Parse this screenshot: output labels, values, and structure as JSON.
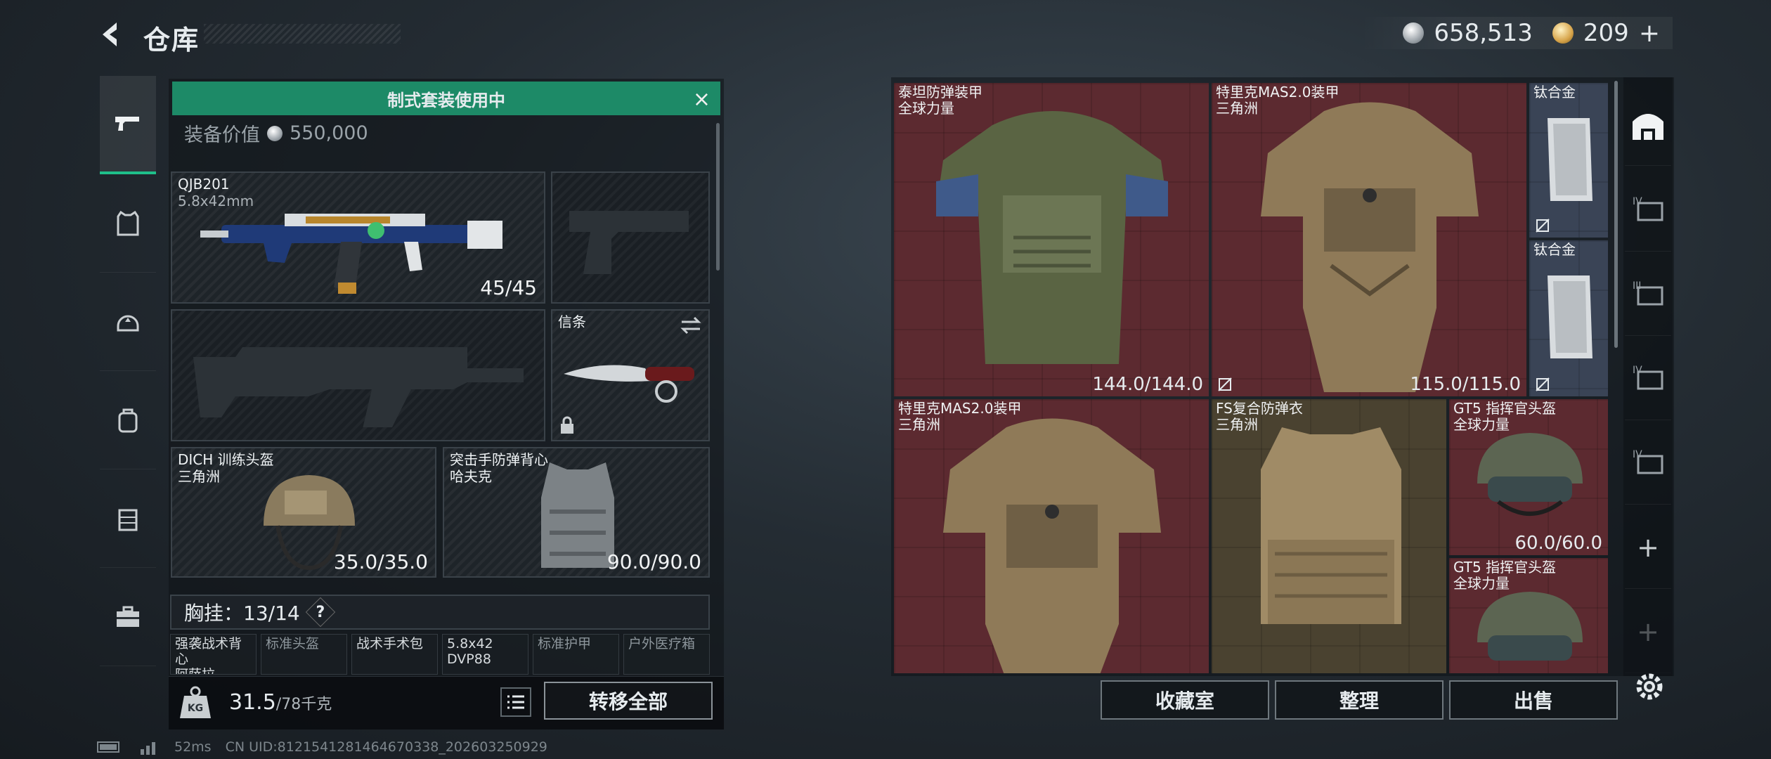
{
  "header": {
    "title": "仓库",
    "back_label": "back"
  },
  "currency": {
    "silver_amount": "658,513",
    "gold_amount": "209",
    "gold_add": "+"
  },
  "kit_banner": {
    "text": "制式套装使用中",
    "close_label": "×"
  },
  "equipment_value": {
    "label": "装备价值",
    "amount": "550,000"
  },
  "slots": {
    "primary": {
      "name": "QJB201",
      "caliber": "5.8x42mm",
      "ammo": "45/45"
    },
    "sidearm": {
      "state": "empty"
    },
    "secondary": {
      "state": "empty"
    },
    "melee": {
      "name": "信条",
      "locked": true
    },
    "helmet": {
      "name": "DICH 训练头盔",
      "brand": "三角洲",
      "durability": "35.0/35.0"
    },
    "armor": {
      "name": "突击手防弹背心",
      "brand": "哈夫克",
      "durability": "90.0/90.0"
    }
  },
  "chest_rig": {
    "label": "胸挂：13/14",
    "help": "?",
    "slots": [
      {
        "label": "强袭战术背心",
        "sub": "阿萨拉",
        "filled": true
      },
      {
        "label": "标准头盔",
        "sub": "",
        "filled": false
      },
      {
        "label": "战术手术包",
        "sub": "",
        "filled": true
      },
      {
        "label": "5.8x42",
        "sub": "DVP88",
        "filled": true
      },
      {
        "label": "标准护甲",
        "sub": "",
        "filled": false
      },
      {
        "label": "户外医疗箱",
        "sub": "",
        "filled": false
      }
    ]
  },
  "bag": {
    "weight": "31.5",
    "capacity": "/78千克"
  },
  "left_buttons": {
    "list_icon": "list-icon",
    "transfer": "转移全部"
  },
  "stash_items": [
    {
      "name": "泰坦防弹装甲",
      "brand": "全球力量",
      "durability": "144.0/144.0",
      "color": "red"
    },
    {
      "name": "特里克MAS2.0装甲",
      "brand": "三角洲",
      "durability": "115.0/115.0",
      "color": "red"
    },
    {
      "name": "钛合金",
      "brand": "",
      "durability": "",
      "color": "blue"
    },
    {
      "name": "钛合金",
      "brand": "",
      "durability": "",
      "color": "blue"
    },
    {
      "name": "特里克MAS2.0装甲",
      "brand": "三角洲",
      "durability": "",
      "color": "red"
    },
    {
      "name": "FS复合防弹衣",
      "brand": "三角洲",
      "durability": "",
      "color": "tan"
    },
    {
      "name": "GT5 指挥官头盔",
      "brand": "全球力量",
      "durability": "60.0/60.0",
      "color": "red"
    },
    {
      "name": "GT5 指挥官头盔",
      "brand": "全球力量",
      "durability": "",
      "color": "red"
    }
  ],
  "right_buttons": {
    "collection": "收藏室",
    "organize": "整理",
    "sell": "出售"
  },
  "rail": {
    "tier_labels": [
      "IV",
      "III",
      "IV",
      "IV"
    ],
    "add": "+"
  },
  "footer": {
    "ping": "52ms",
    "uid": "CN UID:8121541281464670338_202603250929"
  },
  "colors": {
    "accent_green": "#1d8a67",
    "item_red": "#5c2a30",
    "item_tan": "#4a4230",
    "item_blue": "#3a4456"
  }
}
